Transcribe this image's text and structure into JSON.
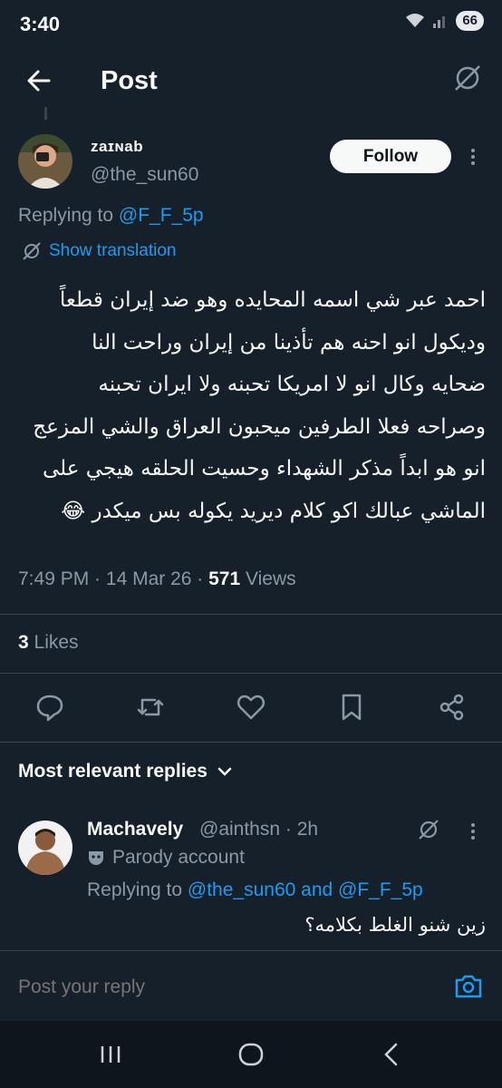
{
  "status_bar": {
    "time": "3:40",
    "battery": "66"
  },
  "header": {
    "title": "Post"
  },
  "post": {
    "author_name": "zaɪɴab",
    "author_handle": "@the_sun60",
    "follow_label": "Follow",
    "replying_prefix": "Replying to",
    "replying_to": "@F_F_5p",
    "show_translation": "Show translation",
    "text_lines": [
      "احمد عبر شي اسمه المحايده وهو ضد إيران قطعاً",
      "وديكول انو احنه هم تأذينا من إيران وراحت النا",
      "ضحايه وكال انو لا امريكا تحبنه ولا ايران تحبنه",
      "وصراحه فعلا الطرفين ميحبون العراق والشي المزعج",
      "انو هو ابداً مذكر الشهداء  وحسيت الحلقه هيجي على",
      "الماشي عبالك اكو كلام ديريد يكوله بس ميكدر 😂"
    ],
    "time": "7:49 PM",
    "date": "14 Mar 26",
    "views_count": "571",
    "views_label": "Views",
    "likes_count": "3",
    "likes_label": "Likes"
  },
  "actions": [
    "reply-icon",
    "repost-icon",
    "like-icon",
    "bookmark-icon",
    "share-icon"
  ],
  "replies_section": {
    "label": "Most relevant replies"
  },
  "reply": {
    "name": "Machavely",
    "handle_time": "@ainthsn · 2h",
    "parody_label": "Parody account",
    "replying_prefix": "Replying to",
    "replying_to": "@the_sun60 and @F_F_5p",
    "text": "زين شنو الغلط بكلامه؟"
  },
  "composer": {
    "placeholder": "Post your reply"
  },
  "colors": {
    "background": "#15202b",
    "accent": "#1d9bf0",
    "muted": "#8b98a5",
    "text": "#f7f9f9"
  }
}
